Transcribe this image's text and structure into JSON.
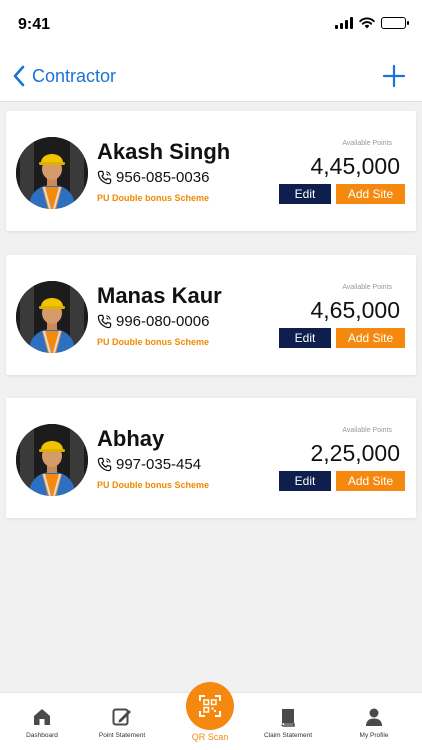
{
  "status_bar": {
    "time": "9:41"
  },
  "header": {
    "back_label": "Contractor"
  },
  "contractors": [
    {
      "name": "Akash Singh",
      "phone": "956-085-0036",
      "scheme": "PU Double bonus Scheme",
      "points_label": "Available Points",
      "points": "4,45,000",
      "edit_label": "Edit",
      "add_site_label": "Add Site"
    },
    {
      "name": "Manas Kaur",
      "phone": "996-080-0006",
      "scheme": "PU Double bonus Scheme",
      "points_label": "Available Points",
      "points": "4,65,000",
      "edit_label": "Edit",
      "add_site_label": "Add Site"
    },
    {
      "name": "Abhay",
      "phone": "997-035-454",
      "scheme": "PU Double bonus Scheme",
      "points_label": "Available Points",
      "points": "2,25,000",
      "edit_label": "Edit",
      "add_site_label": "Add Site"
    }
  ],
  "tabs": {
    "dashboard": "Dashboard",
    "point_statement": "Point Statement",
    "qr_scan": "QR Scan",
    "claim_statement": "Claim Statement",
    "my_profile": "My Profile"
  },
  "colors": {
    "accent": "#f5890f",
    "navy": "#0e1f4d",
    "link": "#1a73d9"
  }
}
